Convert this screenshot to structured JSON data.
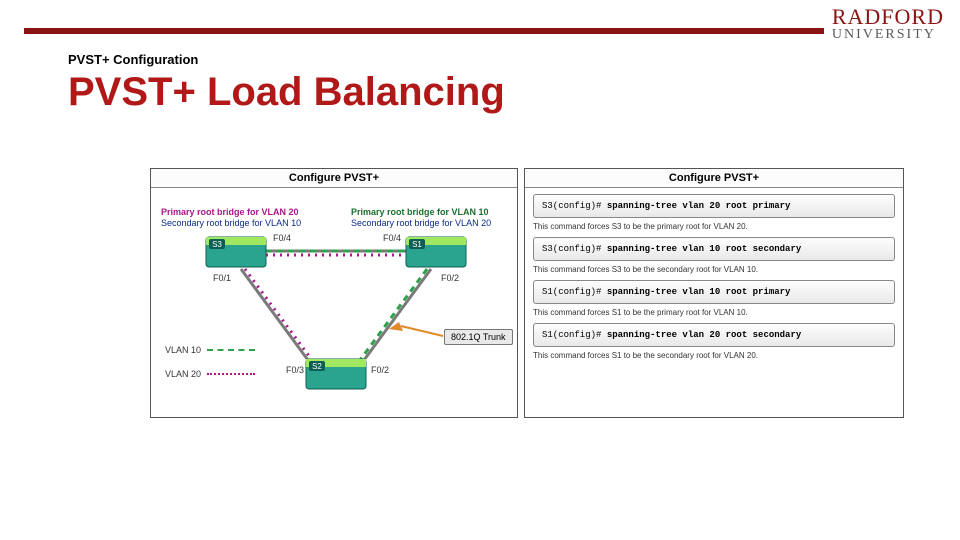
{
  "logo": {
    "line1": "RADFORD",
    "line2": "UNIVERSITY"
  },
  "subtitle": "PVST+ Configuration",
  "title": "PVST+ Load Balancing",
  "left": {
    "header": "Configure PVST+",
    "caption_s3_l1": "Primary root bridge for VLAN 20",
    "caption_s3_l2": "Secondary root bridge for VLAN 10",
    "caption_s1_l1": "Primary root bridge for VLAN 10",
    "caption_s1_l2": "Secondary root bridge for VLAN 20",
    "switches": {
      "s1": "S1",
      "s2": "S2",
      "s3": "S3"
    },
    "ports": {
      "p_f04_l": "F0/4",
      "p_f04_r": "F0/4",
      "p_f01": "F0/1",
      "p_f02t": "F0/2",
      "p_f03": "F0/3",
      "p_f02b": "F0/2"
    },
    "legend": {
      "vlan10": "VLAN 10",
      "vlan20": "VLAN 20"
    },
    "trunk": "802.1Q Trunk"
  },
  "right": {
    "header": "Configure PVST+",
    "items": [
      {
        "prompt": "S3(config)# ",
        "cmd": "spanning-tree vlan 20 root primary",
        "explain": "This command forces S3 to be the primary root for VLAN 20."
      },
      {
        "prompt": "S3(config)# ",
        "cmd": "spanning-tree vlan 10 root secondary",
        "explain": "This command forces S3 to be the secondary root for VLAN 10."
      },
      {
        "prompt": "S1(config)# ",
        "cmd": "spanning-tree vlan 10 root primary",
        "explain": "This command forces S1 to be the primary root for VLAN 10."
      },
      {
        "prompt": "S1(config)# ",
        "cmd": "spanning-tree vlan 20 root secondary",
        "explain": "This command forces S1 to be the secondary root for VLAN 20."
      }
    ]
  }
}
